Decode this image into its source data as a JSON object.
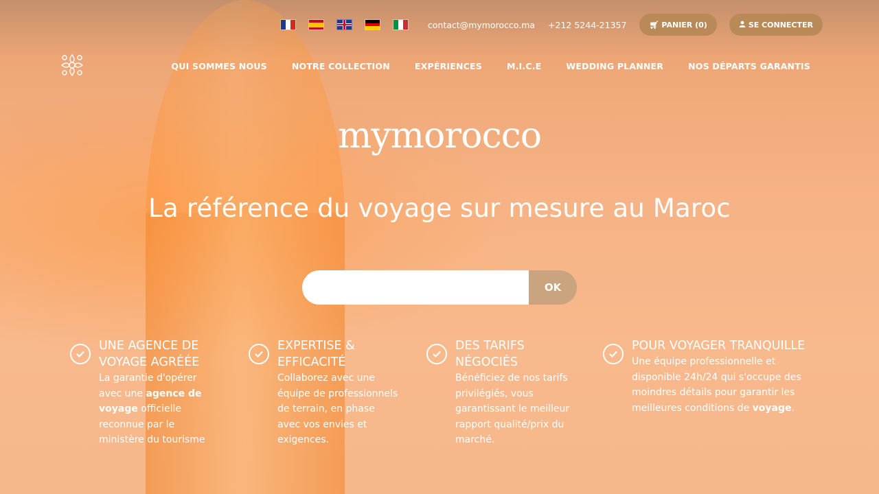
{
  "topbar": {
    "flags": [
      {
        "name": "flag-fr-icon"
      },
      {
        "name": "flag-es-icon"
      },
      {
        "name": "flag-gb-icon"
      },
      {
        "name": "flag-de-icon"
      },
      {
        "name": "flag-it-icon"
      }
    ],
    "email": "contact@mymorocco.ma",
    "phone": "+212 5244-21357",
    "cart_label": "PANIER (0)",
    "login_label": "SE CONNECTER"
  },
  "nav": {
    "items": [
      "QUI SOMMES NOUS",
      "NOTRE COLLECTION",
      "EXPÉRIENCES",
      "M.I.C.E",
      "WEDDING PLANNER",
      "NOS DÉPARTS GARANTIS"
    ]
  },
  "hero": {
    "brand": "mymorocco",
    "headline": "La référence du voyage sur mesure au Maroc"
  },
  "search": {
    "value": "",
    "placeholder": "",
    "button_label": "OK"
  },
  "features": [
    {
      "title": "UNE AGENCE DE VOYAGE AGRÉÉE",
      "text_before": "La garantie d'opérer avec une ",
      "text_bold": "agence de voyage",
      "text_after": " officielle reconnue par le ministère du tourisme"
    },
    {
      "title": "EXPERTISE & EFFICACITÉ",
      "text_before": "Collaborez avec une équipe de professionnels de terrain, en phase avec vos envies et exigences.",
      "text_bold": "",
      "text_after": ""
    },
    {
      "title": "DES TARIFS NÉGOCIÉS",
      "text_before": "Bénéficiez de nos tarifs privilégiés, vous garantissant le meilleur rapport qualité/prix du marché.",
      "text_bold": "",
      "text_after": ""
    },
    {
      "title": "POUR VOYAGER TRANQUILLE",
      "text_before": "Une équipe professionnelle et disponible 24h/24 qui s'occupe des moindres détails pour garantir les meilleures conditions de ",
      "text_bold": "voyage",
      "text_after": "."
    }
  ],
  "colors": {
    "accent": "#b98a58",
    "search_button": "#c9a47f",
    "text": "#ffffff"
  }
}
